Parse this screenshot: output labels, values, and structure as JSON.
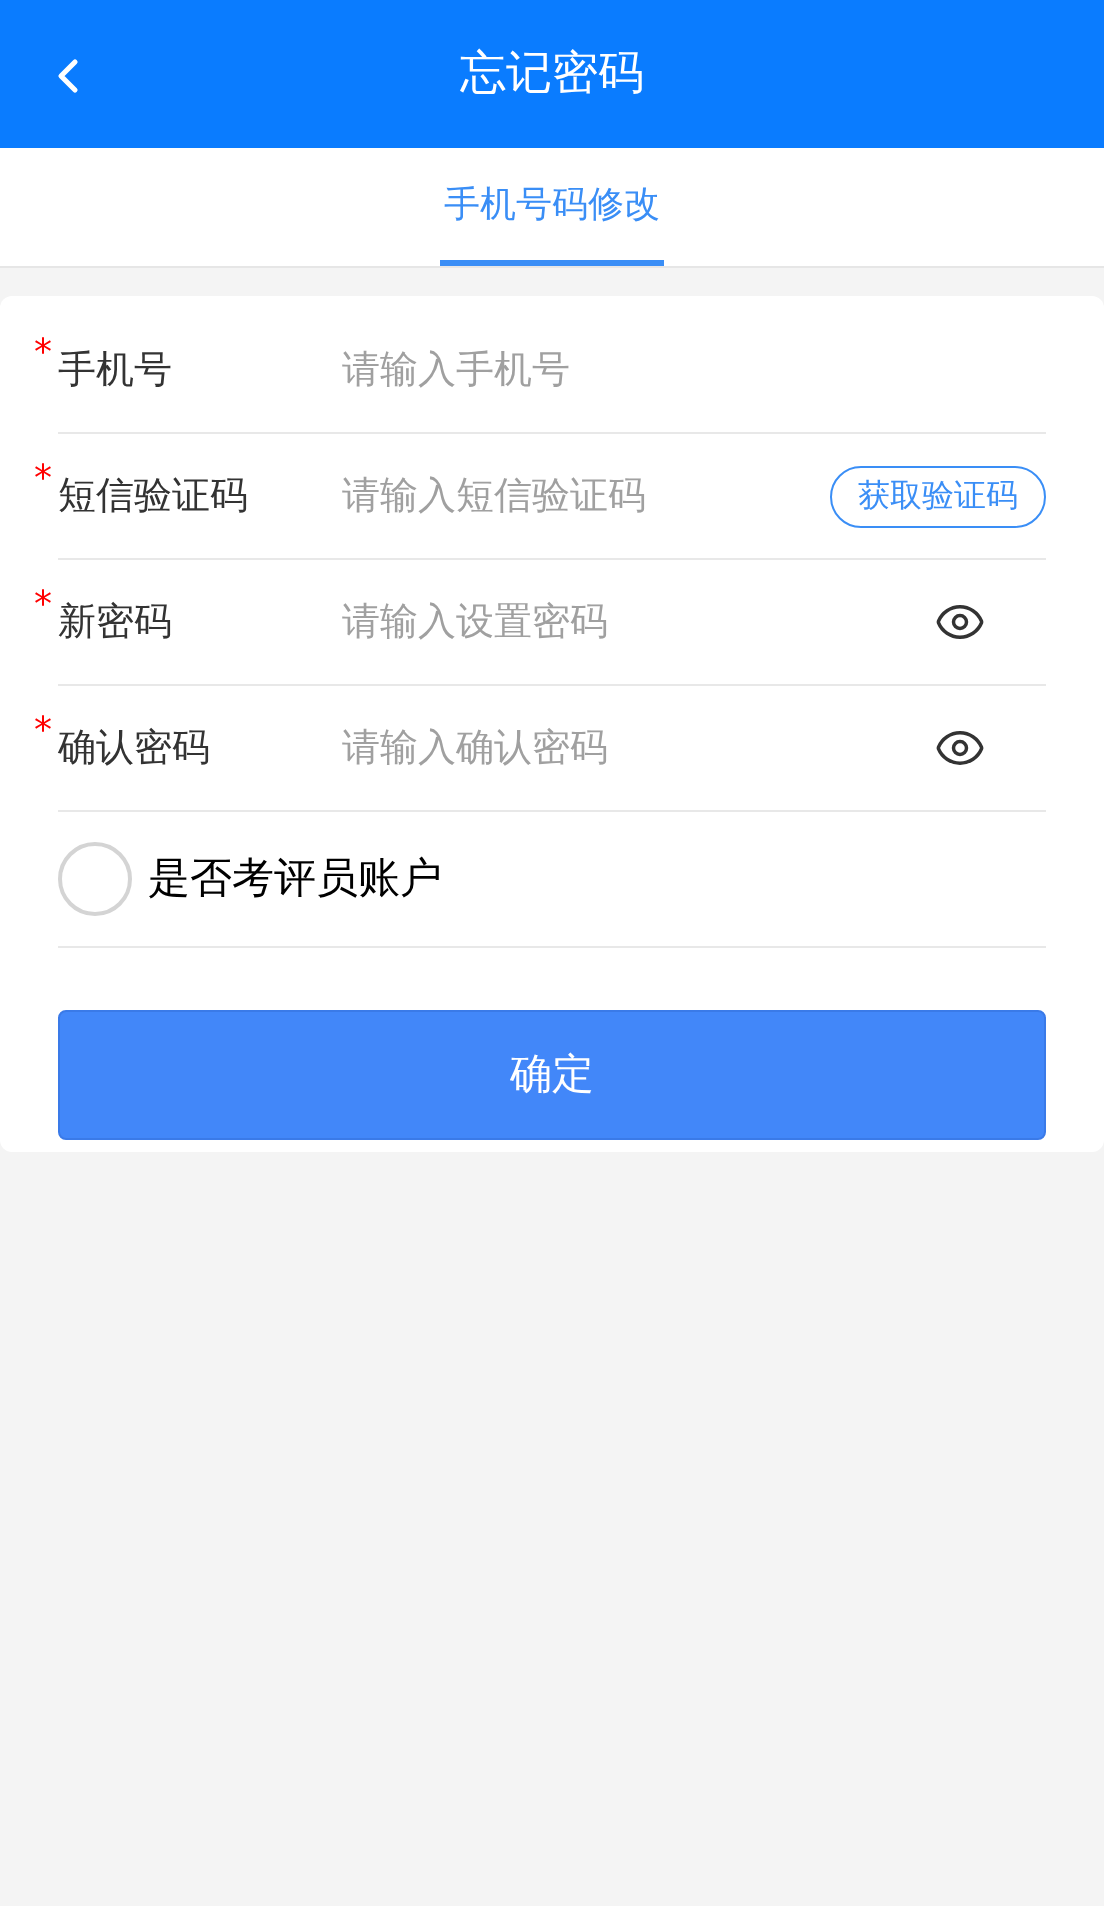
{
  "header": {
    "title": "忘记密码"
  },
  "tabs": [
    {
      "label": "手机号码修改",
      "selected": true
    }
  ],
  "fields": [
    {
      "kind": "text",
      "required_mark": "*",
      "label": "手机号",
      "placeholder": "请输入手机号"
    },
    {
      "kind": "code",
      "required_mark": "*",
      "label": "短信验证码",
      "placeholder": "请输入短信验证码",
      "action": "获取验证码"
    },
    {
      "kind": "password",
      "required_mark": "*",
      "label": "新密码",
      "placeholder": "请输入设置密码"
    },
    {
      "kind": "password",
      "required_mark": "*",
      "label": "确认密码",
      "placeholder": "请输入确认密码"
    }
  ],
  "checkbox": {
    "label": "是否考评员账户",
    "checked": false
  },
  "submit": "确定"
}
